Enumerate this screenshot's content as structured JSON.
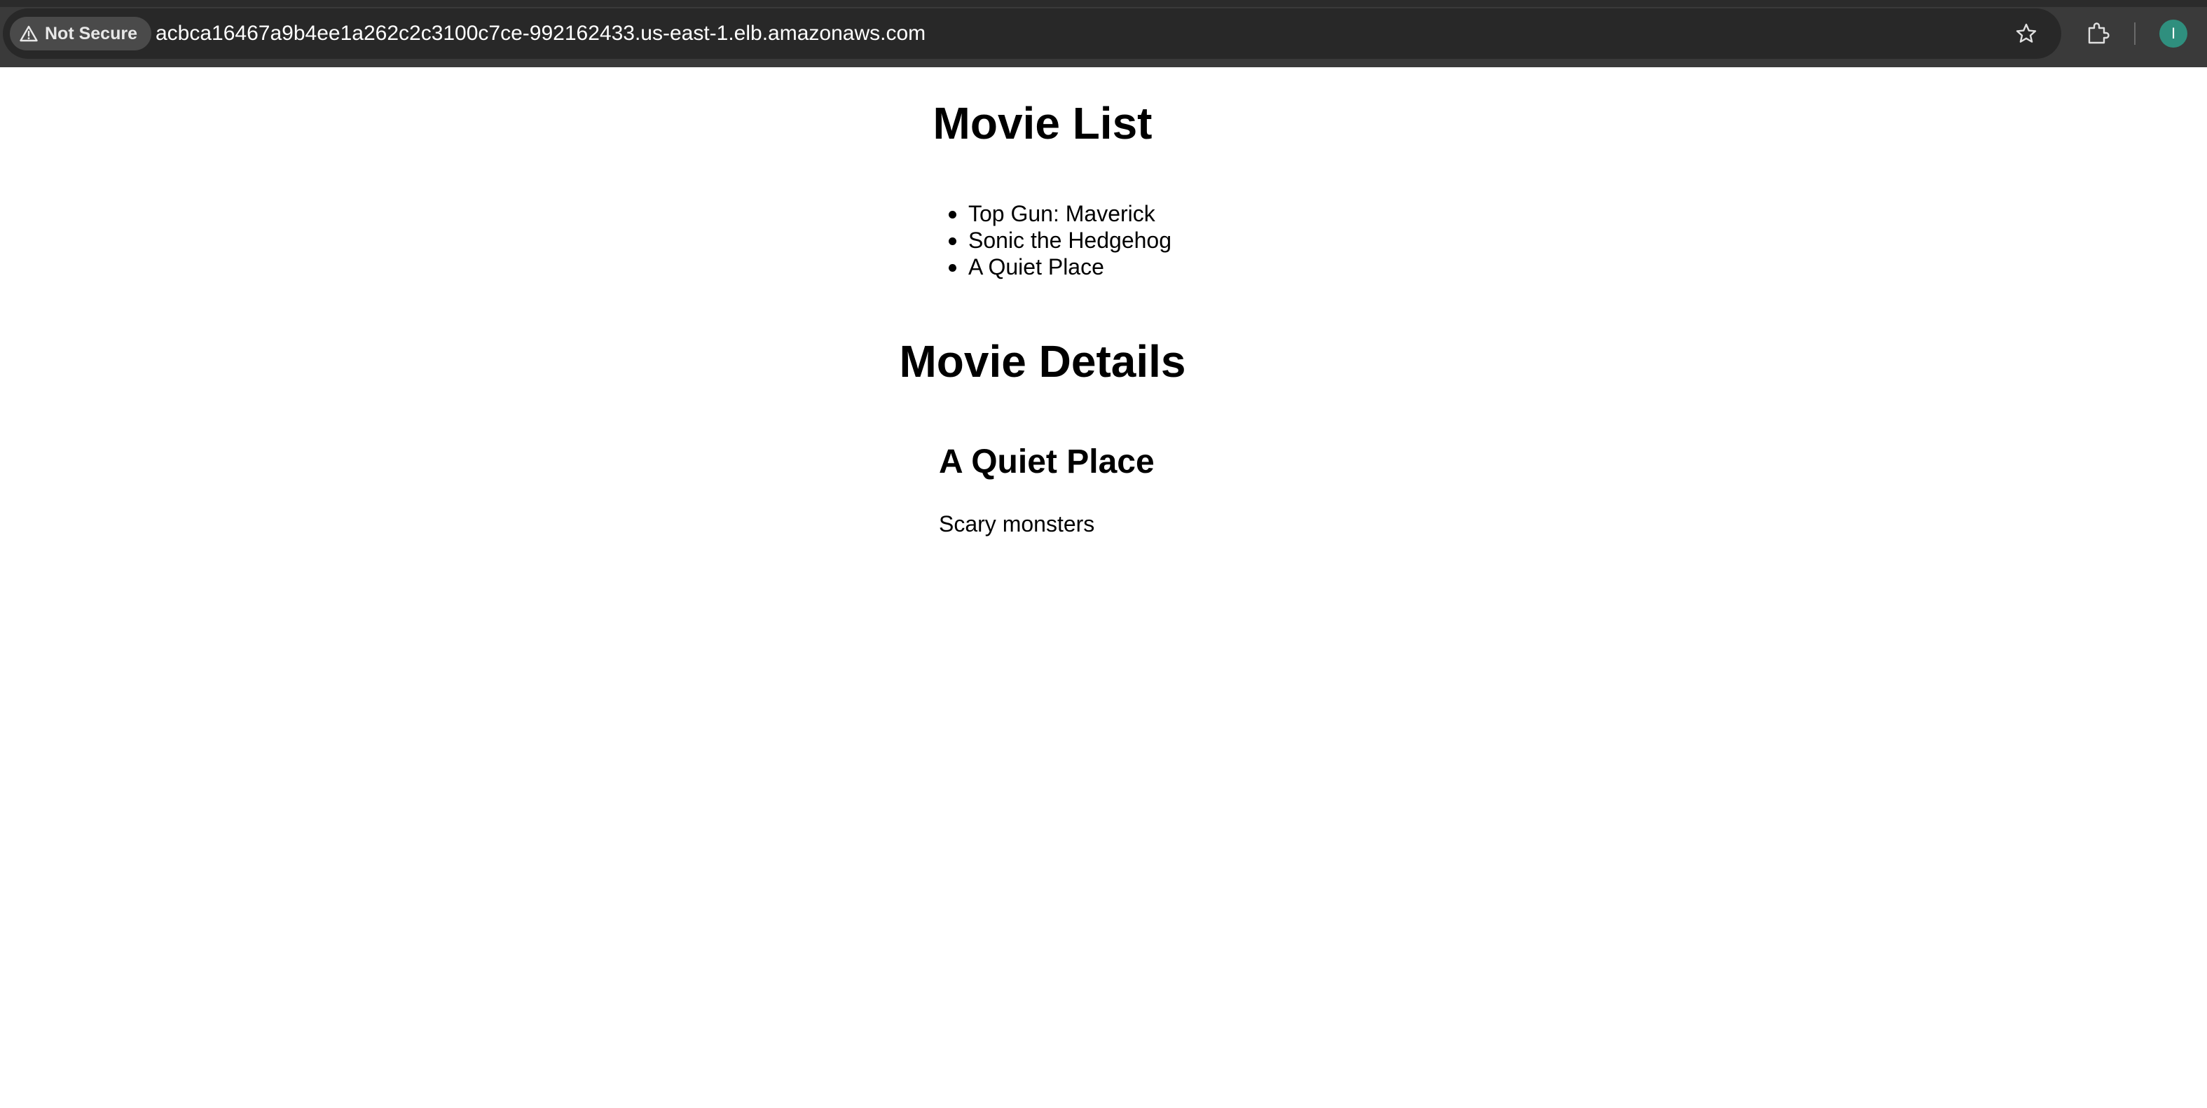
{
  "browser": {
    "security_label": "Not Secure",
    "url": "acbca16467a9b4ee1a262c2c3100c7ce-992162433.us-east-1.elb.amazonaws.com",
    "avatar_initial": "I",
    "avatar_color": "#2f8f7e",
    "icons": [
      "warning-triangle-icon",
      "star-icon",
      "puzzle-extension-icon"
    ]
  },
  "page": {
    "list_heading": "Movie List",
    "movies": [
      {
        "title": "Top Gun: Maverick"
      },
      {
        "title": "Sonic the Hedgehog"
      },
      {
        "title": "A Quiet Place"
      }
    ],
    "details_heading": "Movie Details",
    "selected": {
      "title": "A Quiet Place",
      "description": "Scary monsters"
    }
  }
}
